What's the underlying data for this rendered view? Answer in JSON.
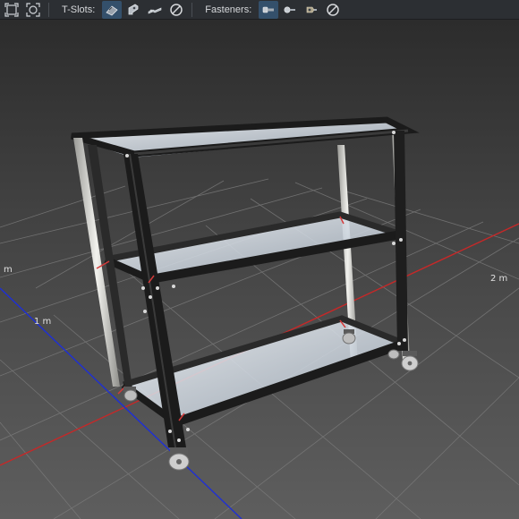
{
  "toolbar": {
    "tslots_label": "T-Slots:",
    "fasteners_label": "Fasteners:",
    "tslot_tools": [
      {
        "icon": "tslot-profile-icon",
        "active": true
      },
      {
        "icon": "tslot-bracket-icon",
        "active": false
      },
      {
        "icon": "tslot-connector-icon",
        "active": false
      },
      {
        "icon": "tslot-none-icon",
        "active": false
      }
    ],
    "fastener_tools": [
      {
        "icon": "bolt-icon",
        "active": true
      },
      {
        "icon": "screw-icon",
        "active": false
      },
      {
        "icon": "nut-icon",
        "active": false
      },
      {
        "icon": "fastener-none-icon",
        "active": false
      }
    ],
    "view_tools": [
      "fit-view-icon",
      "zoom-extents-icon"
    ]
  },
  "viewport": {
    "axis_labels": {
      "x_neg": "m",
      "x_1": "1 m",
      "x_2": "2 m"
    },
    "colors": {
      "background_top": "#2f2f2f",
      "background_floor": "#5a5a5a",
      "grid": "#7a7a7a",
      "x_axis": "#c62828",
      "z_axis": "#1e2fd6",
      "frame_black": "#1b1b1b",
      "frame_silver": "#d8d8d4",
      "shelf_glass": "#dfe6ee"
    }
  }
}
